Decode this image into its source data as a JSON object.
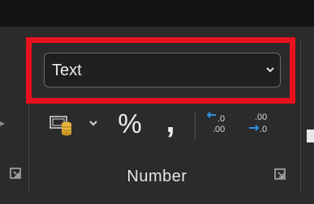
{
  "number_group": {
    "format_dropdown_value": "Text",
    "percent_symbol": "%",
    "comma_symbol": ",",
    "group_label": "Number",
    "increase_decimal_icon": "increase-decimal-icon",
    "decrease_decimal_icon": "decrease-decimal-icon",
    "accounting_icon": "accounting-format-icon"
  },
  "colors": {
    "highlight": "#e8121d",
    "ribbon_bg": "#2b2b2b",
    "decimal_arrow": "#2f8fe0"
  }
}
